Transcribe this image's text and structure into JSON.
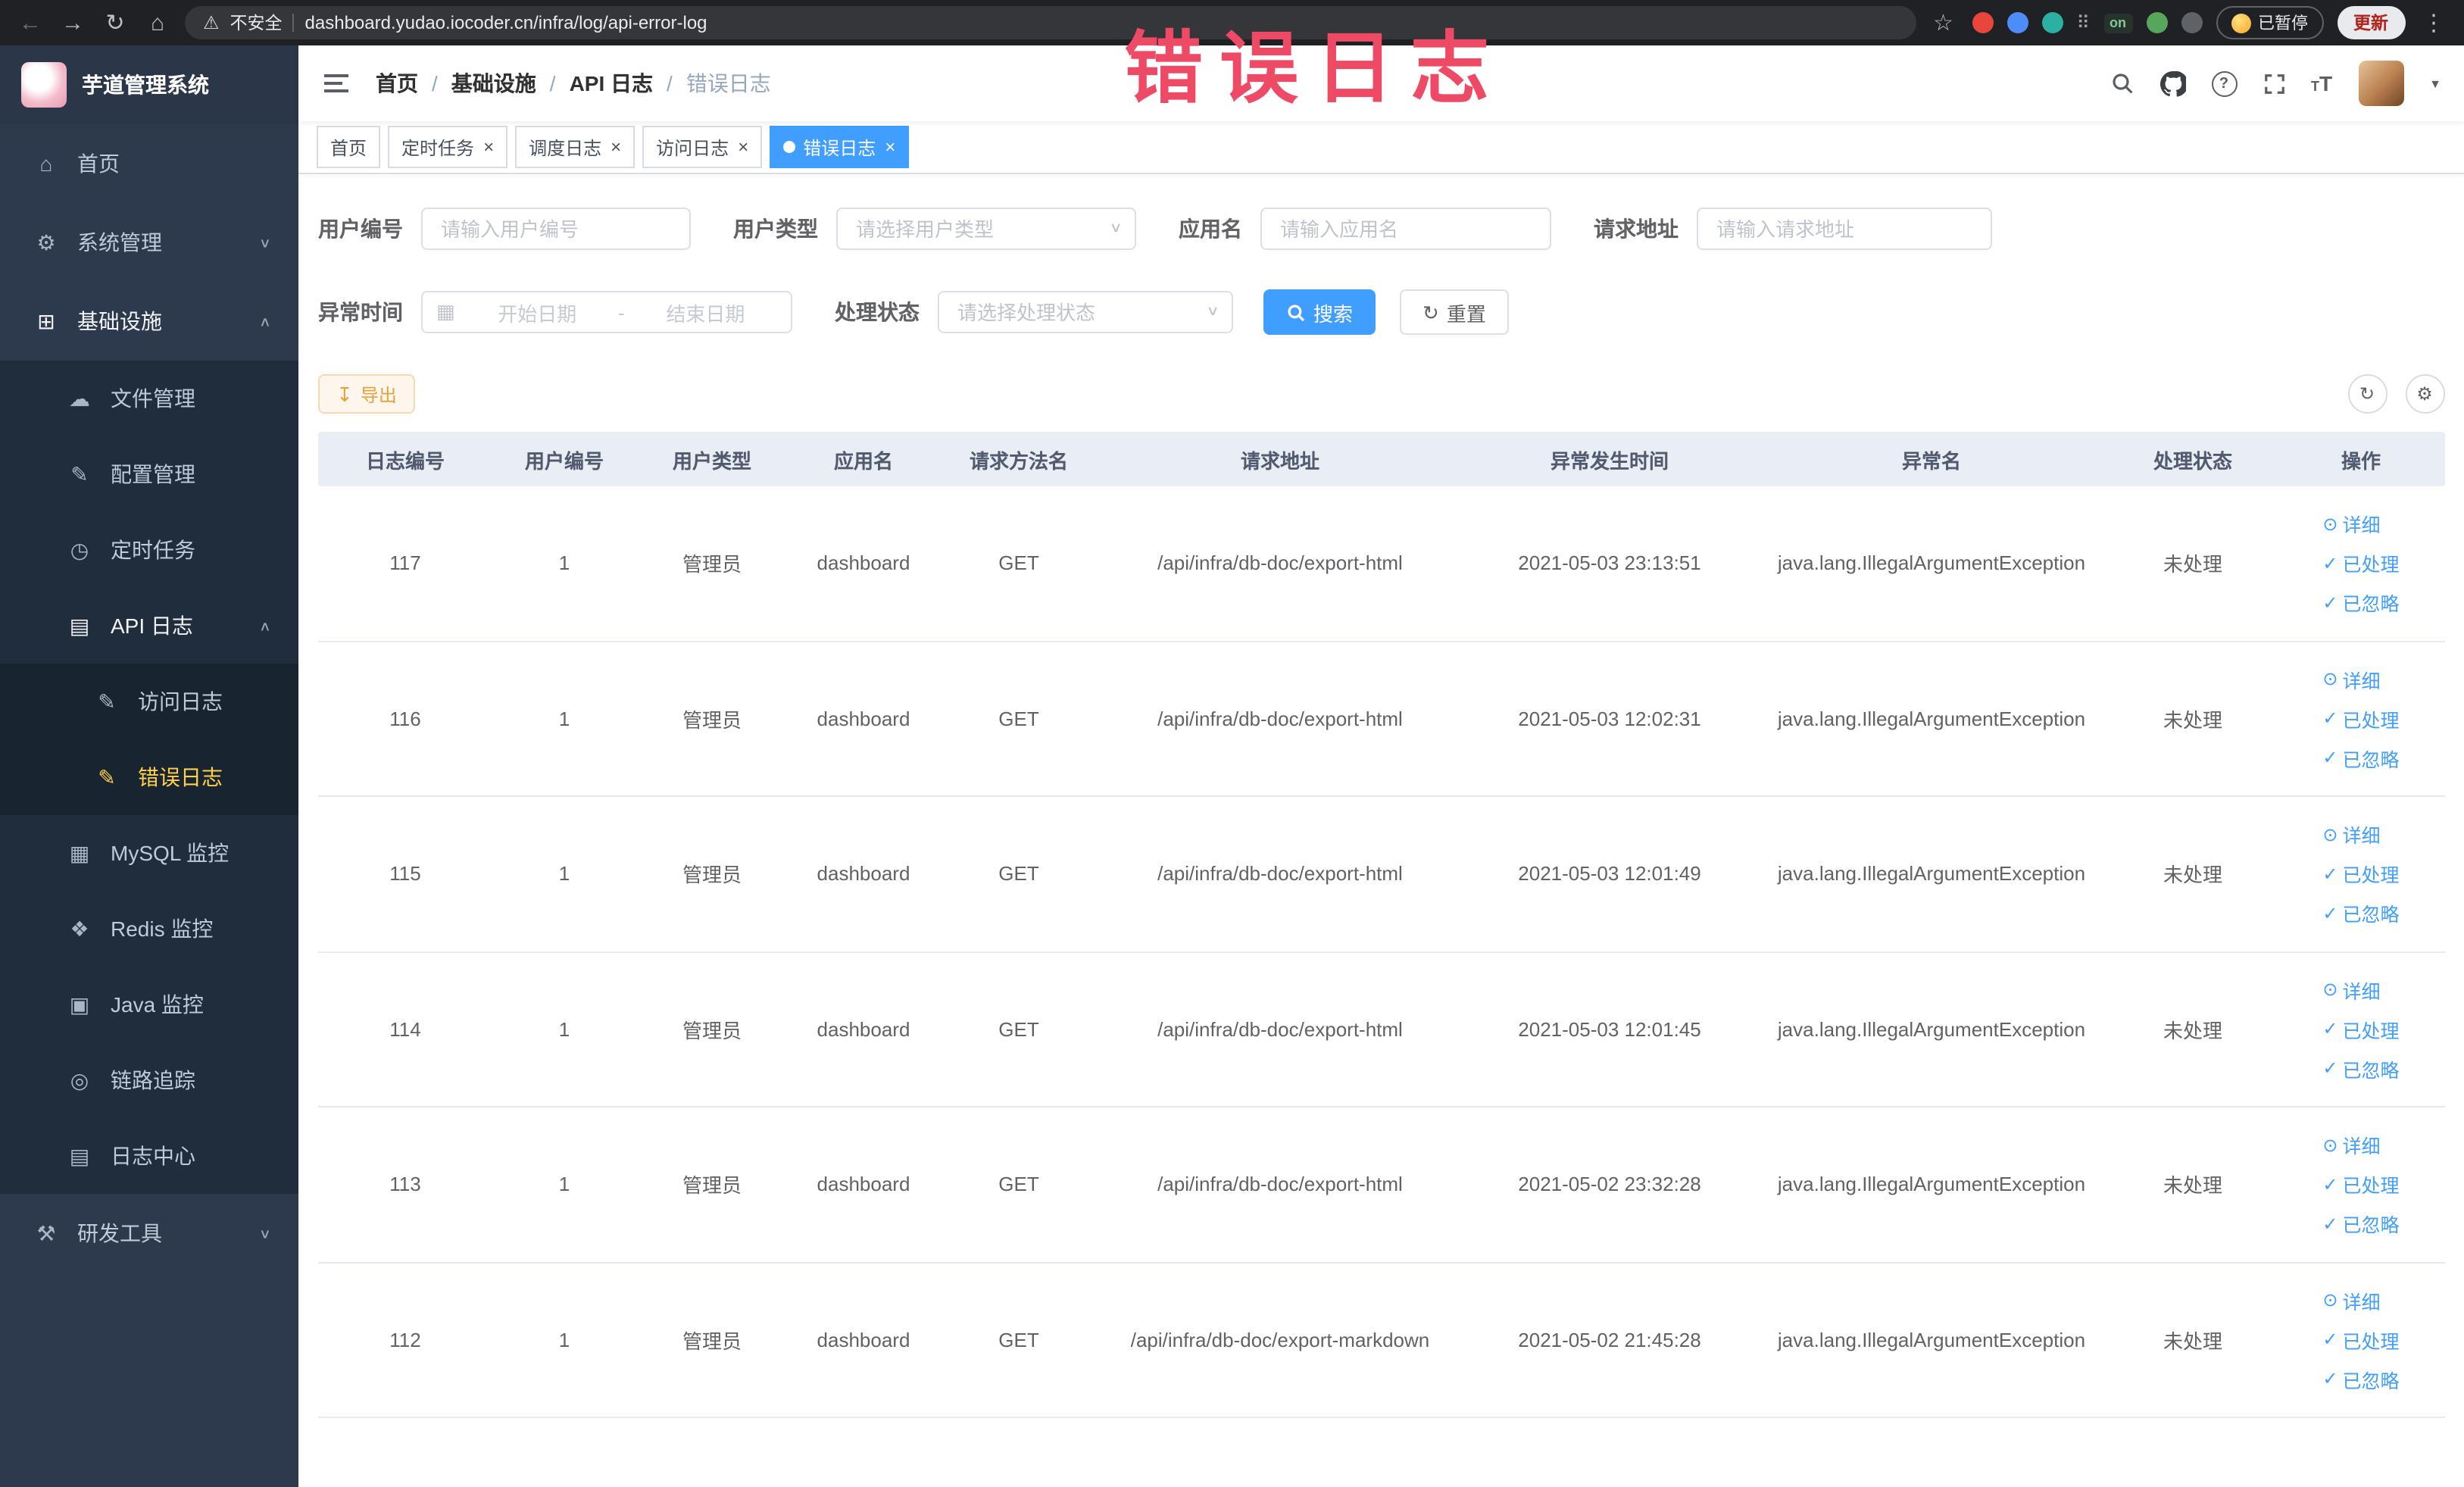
{
  "watermark": "错误日志",
  "icons": {
    "back": "←",
    "forward": "→",
    "reload": "↻",
    "home": "⌂",
    "warning": "⚠",
    "star": "☆",
    "kebab": "⋮",
    "grid": "⠿",
    "on_badge": "on",
    "chevron_down": "∨",
    "chevron_up": "∧",
    "close": "×",
    "calendar": "▦",
    "refresh": "↻",
    "gear": "⚙",
    "download": "↧",
    "eye": "⊙",
    "check": "✓",
    "caret_down": "▼"
  },
  "browser": {
    "security_text": "不安全",
    "url": "dashboard.yudao.iocoder.cn/infra/log/api-error-log",
    "paused_text": "已暂停",
    "update_label": "更新"
  },
  "sidebar": {
    "title": "芋道管理系统",
    "items": [
      {
        "icon": "home-icon",
        "glyph": "⌂",
        "label": "首页",
        "level": "lv1",
        "suffix": ""
      },
      {
        "icon": "gear-icon",
        "glyph": "⚙",
        "label": "系统管理",
        "level": "lv1",
        "suffix": "∨"
      },
      {
        "icon": "infrastructure-icon",
        "glyph": "⊞",
        "label": "基础设施",
        "level": "lv1",
        "suffix": "∧",
        "open": true
      },
      {
        "icon": "file-manage-icon",
        "glyph": "☁",
        "label": "文件管理",
        "level": "lv2",
        "suffix": ""
      },
      {
        "icon": "config-manage-icon",
        "glyph": "✎",
        "label": "配置管理",
        "level": "lv2",
        "suffix": ""
      },
      {
        "icon": "scheduled-job-icon",
        "glyph": "◷",
        "label": "定时任务",
        "level": "lv2",
        "suffix": ""
      },
      {
        "icon": "api-log-icon",
        "glyph": "▤",
        "label": "API 日志",
        "level": "lv2",
        "suffix": "∧",
        "open": true
      },
      {
        "icon": "access-log-icon",
        "glyph": "✎",
        "label": "访问日志",
        "level": "lv3",
        "suffix": ""
      },
      {
        "icon": "error-log-icon",
        "glyph": "✎",
        "label": "错误日志",
        "level": "lv3",
        "suffix": "",
        "active": true
      },
      {
        "icon": "mysql-monitor-icon",
        "glyph": "▦",
        "label": "MySQL 监控",
        "level": "lv2",
        "suffix": ""
      },
      {
        "icon": "redis-monitor-icon",
        "glyph": "❖",
        "label": "Redis 监控",
        "level": "lv2",
        "suffix": ""
      },
      {
        "icon": "java-monitor-icon",
        "glyph": "▣",
        "label": "Java 监控",
        "level": "lv2",
        "suffix": ""
      },
      {
        "icon": "trace-icon",
        "glyph": "◎",
        "label": "链路追踪",
        "level": "lv2",
        "suffix": ""
      },
      {
        "icon": "log-center-icon",
        "glyph": "▤",
        "label": "日志中心",
        "level": "lv2",
        "suffix": ""
      },
      {
        "icon": "dev-tools-icon",
        "glyph": "⚒",
        "label": "研发工具",
        "level": "lv1",
        "suffix": "∨"
      }
    ]
  },
  "breadcrumb": {
    "items": [
      {
        "label": "首页",
        "sep": "/"
      },
      {
        "label": "基础设施",
        "sep": "/"
      },
      {
        "label": "API 日志",
        "sep": "/"
      },
      {
        "label": "错误日志",
        "sep": "",
        "current": true
      }
    ]
  },
  "tabs": [
    {
      "label": "首页",
      "closable": false,
      "active": false
    },
    {
      "label": "定时任务",
      "closable": true,
      "active": false
    },
    {
      "label": "调度日志",
      "closable": true,
      "active": false
    },
    {
      "label": "访问日志",
      "closable": true,
      "active": false
    },
    {
      "label": "错误日志",
      "closable": true,
      "active": true
    }
  ],
  "filters": {
    "user_id": {
      "label": "用户编号",
      "placeholder": "请输入用户编号"
    },
    "user_type": {
      "label": "用户类型",
      "placeholder": "请选择用户类型"
    },
    "app_name": {
      "label": "应用名",
      "placeholder": "请输入应用名"
    },
    "request_url": {
      "label": "请求地址",
      "placeholder": "请输入请求地址"
    },
    "exception_time": {
      "label": "异常时间",
      "start_placeholder": "开始日期",
      "range_separator": "-",
      "end_placeholder": "结束日期"
    },
    "process_status": {
      "label": "处理状态",
      "placeholder": "请选择处理状态"
    },
    "search_label": "搜索",
    "reset_label": "重置"
  },
  "toolbar": {
    "export_label": "导出"
  },
  "table": {
    "columns": [
      {
        "label": "日志编号"
      },
      {
        "label": "用户编号"
      },
      {
        "label": "用户类型"
      },
      {
        "label": "应用名"
      },
      {
        "label": "请求方法名"
      },
      {
        "label": "请求地址"
      },
      {
        "label": "异常发生时间"
      },
      {
        "label": "异常名"
      },
      {
        "label": "处理状态"
      },
      {
        "label": "操作"
      }
    ],
    "rows": [
      {
        "id": "117",
        "user_id": "1",
        "user_type": "管理员",
        "app_name": "dashboard",
        "method": "GET",
        "url": "/api/infra/db-doc/export-html",
        "time": "2021-05-03 23:13:51",
        "exception": "java.lang.IllegalArgumentException",
        "status": "未处理"
      },
      {
        "id": "116",
        "user_id": "1",
        "user_type": "管理员",
        "app_name": "dashboard",
        "method": "GET",
        "url": "/api/infra/db-doc/export-html",
        "time": "2021-05-03 12:02:31",
        "exception": "java.lang.IllegalArgumentException",
        "status": "未处理"
      },
      {
        "id": "115",
        "user_id": "1",
        "user_type": "管理员",
        "app_name": "dashboard",
        "method": "GET",
        "url": "/api/infra/db-doc/export-html",
        "time": "2021-05-03 12:01:49",
        "exception": "java.lang.IllegalArgumentException",
        "status": "未处理"
      },
      {
        "id": "114",
        "user_id": "1",
        "user_type": "管理员",
        "app_name": "dashboard",
        "method": "GET",
        "url": "/api/infra/db-doc/export-html",
        "time": "2021-05-03 12:01:45",
        "exception": "java.lang.IllegalArgumentException",
        "status": "未处理"
      },
      {
        "id": "113",
        "user_id": "1",
        "user_type": "管理员",
        "app_name": "dashboard",
        "method": "GET",
        "url": "/api/infra/db-doc/export-html",
        "time": "2021-05-02 23:32:28",
        "exception": "java.lang.IllegalArgumentException",
        "status": "未处理"
      },
      {
        "id": "112",
        "user_id": "1",
        "user_type": "管理员",
        "app_name": "dashboard",
        "method": "GET",
        "url": "/api/infra/db-doc/export-markdown",
        "time": "2021-05-02 21:45:28",
        "exception": "java.lang.IllegalArgumentException",
        "status": "未处理"
      }
    ]
  },
  "actions": [
    {
      "icon": "eye-icon",
      "label": "详细"
    },
    {
      "icon": "check-icon",
      "label": "已处理"
    },
    {
      "icon": "check-icon",
      "label": "已忽略"
    }
  ]
}
